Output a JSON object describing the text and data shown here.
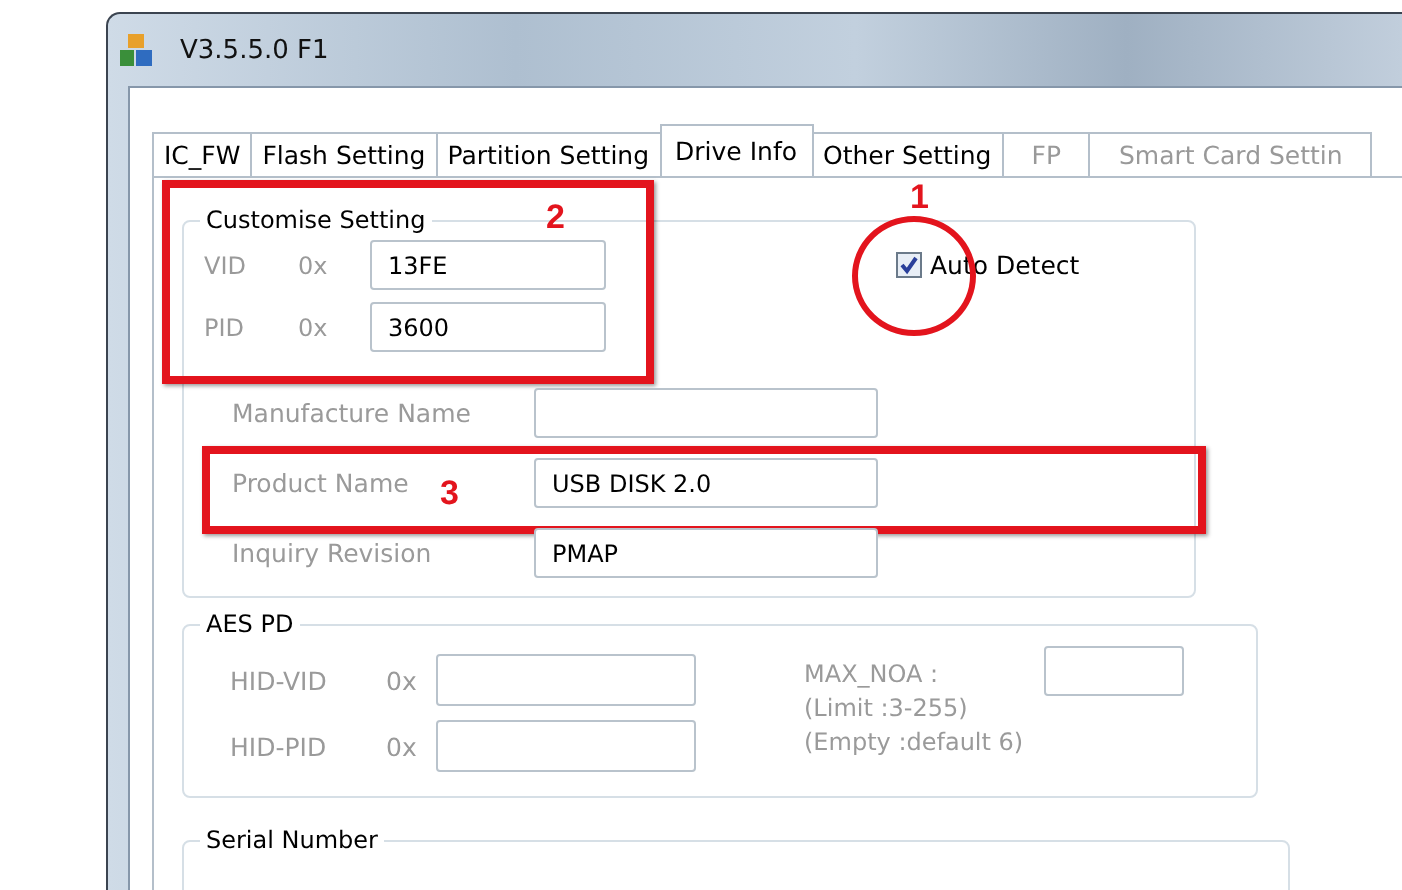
{
  "window": {
    "title": "V3.5.5.0 F1"
  },
  "tabs": [
    {
      "label": "IC_FW",
      "selected": false,
      "disabled": false
    },
    {
      "label": "Flash Setting",
      "selected": false,
      "disabled": false
    },
    {
      "label": "Partition Setting",
      "selected": false,
      "disabled": false
    },
    {
      "label": "Drive Info",
      "selected": true,
      "disabled": false
    },
    {
      "label": "Other Setting",
      "selected": false,
      "disabled": false
    },
    {
      "label": "FP",
      "selected": false,
      "disabled": true
    },
    {
      "label": "Smart Card Settin",
      "selected": false,
      "disabled": true
    }
  ],
  "customise_setting": {
    "title": "Customise Setting",
    "annotation": "2",
    "ids": [
      {
        "label": "VID",
        "prefix": "0x",
        "value": "13FE"
      },
      {
        "label": "PID",
        "prefix": "0x",
        "value": "3600"
      }
    ],
    "auto_detect": {
      "label": "Auto Detect",
      "checked": true,
      "annotation": "1"
    },
    "fields": [
      {
        "label": "Manufacture Name"
      },
      {
        "label": "Product Name",
        "value": "USB DISK 2.0",
        "annotation": "3"
      },
      {
        "label": "Inquiry Revision",
        "value": "PMAP"
      }
    ]
  },
  "aes_pd": {
    "title": "AES PD",
    "ids": [
      {
        "label": "HID-VID",
        "prefix": "0x"
      },
      {
        "label": "HID-PID",
        "prefix": "0x"
      }
    ],
    "max_noa": [
      "MAX_NOA :",
      "(Limit :3-255)",
      "(Empty :default 6)"
    ]
  },
  "serial_number": {
    "title": "Serial Number"
  }
}
